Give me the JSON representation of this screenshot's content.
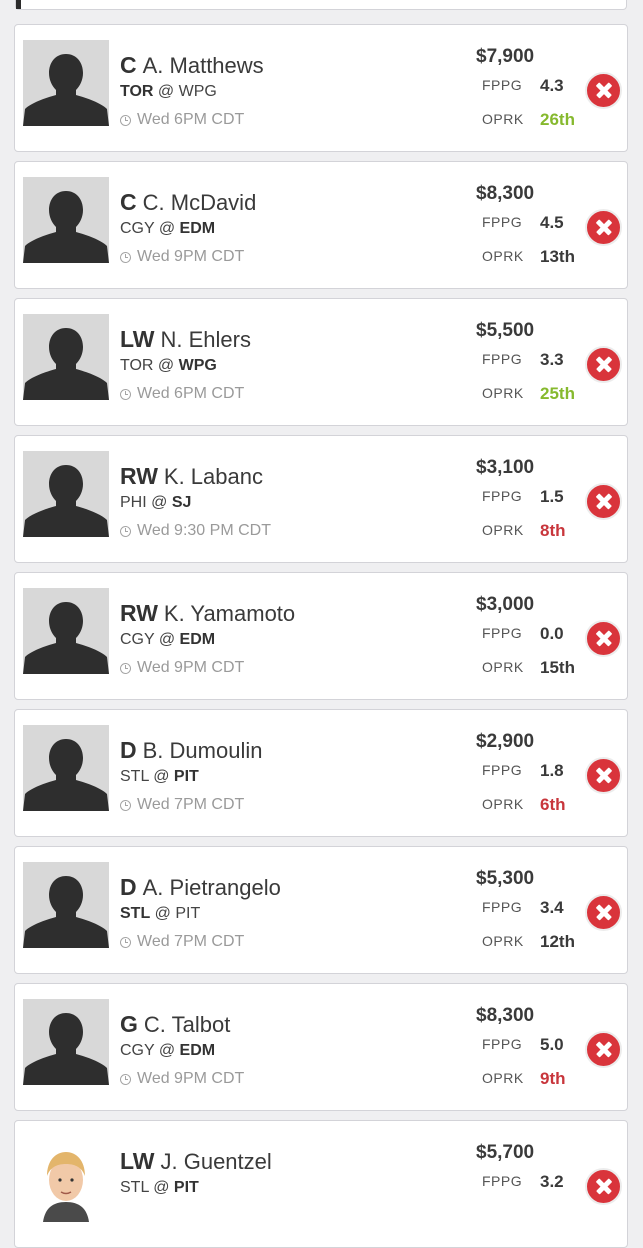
{
  "colors": {
    "rank_good": "#86b92e",
    "rank_bad": "#c8363c",
    "rank_neutral": "#3a3a3a",
    "remove_button": "#d9343b"
  },
  "labels": {
    "fppg": "FPPG",
    "oprk": "OPRK"
  },
  "players": [
    {
      "pos": "C",
      "name": "A. Matthews",
      "home_team": "TOR",
      "sep": " @ ",
      "away_team": "WPG",
      "bold": "home",
      "time": "Wed 6PM CDT",
      "salary": "$7,900",
      "fppg": "4.3",
      "oprk": "26th",
      "rank_tone": "good",
      "avatar": "silhouette-icon"
    },
    {
      "pos": "C",
      "name": "C. McDavid",
      "home_team": "CGY",
      "sep": " @ ",
      "away_team": "EDM",
      "bold": "away",
      "time": "Wed 9PM CDT",
      "salary": "$8,300",
      "fppg": "4.5",
      "oprk": "13th",
      "rank_tone": "neutral",
      "avatar": "silhouette-icon"
    },
    {
      "pos": "LW",
      "name": "N. Ehlers",
      "home_team": "TOR",
      "sep": " @ ",
      "away_team": "WPG",
      "bold": "away",
      "time": "Wed 6PM CDT",
      "salary": "$5,500",
      "fppg": "3.3",
      "oprk": "25th",
      "rank_tone": "good",
      "avatar": "silhouette-icon"
    },
    {
      "pos": "RW",
      "name": "K. Labanc",
      "home_team": "PHI",
      "sep": " @ ",
      "away_team": "SJ",
      "bold": "away",
      "time": "Wed 9:30 PM CDT",
      "salary": "$3,100",
      "fppg": "1.5",
      "oprk": "8th",
      "rank_tone": "bad",
      "avatar": "silhouette-icon"
    },
    {
      "pos": "RW",
      "name": "K. Yamamoto",
      "home_team": "CGY",
      "sep": " @ ",
      "away_team": "EDM",
      "bold": "away",
      "time": "Wed 9PM CDT",
      "salary": "$3,000",
      "fppg": "0.0",
      "oprk": "15th",
      "rank_tone": "neutral",
      "avatar": "silhouette-icon"
    },
    {
      "pos": "D",
      "name": "B. Dumoulin",
      "home_team": "STL",
      "sep": " @ ",
      "away_team": "PIT",
      "bold": "away",
      "time": "Wed 7PM CDT",
      "salary": "$2,900",
      "fppg": "1.8",
      "oprk": "6th",
      "rank_tone": "bad",
      "avatar": "silhouette-icon"
    },
    {
      "pos": "D",
      "name": "A. Pietrangelo",
      "home_team": "STL",
      "sep": " @ ",
      "away_team": "PIT",
      "bold": "home",
      "time": "Wed 7PM CDT",
      "salary": "$5,300",
      "fppg": "3.4",
      "oprk": "12th",
      "rank_tone": "neutral",
      "avatar": "silhouette-icon"
    },
    {
      "pos": "G",
      "name": "C. Talbot",
      "home_team": "CGY",
      "sep": " @ ",
      "away_team": "EDM",
      "bold": "away",
      "time": "Wed 9PM CDT",
      "salary": "$8,300",
      "fppg": "5.0",
      "oprk": "9th",
      "rank_tone": "bad",
      "avatar": "silhouette-icon"
    },
    {
      "pos": "LW",
      "name": "J. Guentzel",
      "home_team": "STL",
      "sep": " @ ",
      "away_team": "PIT",
      "bold": "away",
      "time": "",
      "salary": "$5,700",
      "fppg": "3.2",
      "oprk": "",
      "rank_tone": "neutral",
      "avatar": "player-photo-icon"
    }
  ]
}
